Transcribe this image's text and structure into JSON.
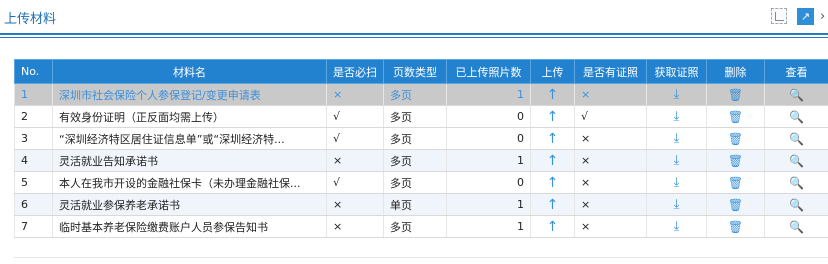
{
  "page": {
    "title": "上传材料"
  },
  "table": {
    "headers": [
      "No.",
      "材料名",
      "是否必扫",
      "页数类型",
      "已上传照片数",
      "上传",
      "是否有证照",
      "获取证照",
      "删除",
      "查看"
    ],
    "rows": [
      {
        "no": "1",
        "name": "深圳市社会保险个人参保登记/变更申请表",
        "required": "×",
        "page_type": "多页",
        "uploaded": "1",
        "upload_icon": "↑",
        "has_license": "×",
        "fetch_icon": "⤓",
        "delete_icon": "🗑",
        "view_icon": "🔍"
      },
      {
        "no": "2",
        "name": "有效身份证明（正反面均需上传）",
        "required": "√",
        "page_type": "多页",
        "uploaded": "0",
        "upload_icon": "↑",
        "has_license": "√",
        "fetch_icon": "⤓",
        "delete_icon": "🗑",
        "view_icon": "🔍"
      },
      {
        "no": "3",
        "name": "“深圳经济特区居住证信息单”或“深圳经济特...",
        "required": "√",
        "page_type": "多页",
        "uploaded": "0",
        "upload_icon": "↑",
        "has_license": "×",
        "fetch_icon": "⤓",
        "delete_icon": "🗑",
        "view_icon": "🔍"
      },
      {
        "no": "4",
        "name": "灵活就业告知承诺书",
        "required": "×",
        "page_type": "多页",
        "uploaded": "1",
        "upload_icon": "↑",
        "has_license": "×",
        "fetch_icon": "⤓",
        "delete_icon": "🗑",
        "view_icon": "🔍"
      },
      {
        "no": "5",
        "name": "本人在我市开设的金融社保卡（未办理金融社保...",
        "required": "√",
        "page_type": "多页",
        "uploaded": "0",
        "upload_icon": "↑",
        "has_license": "×",
        "fetch_icon": "⤓",
        "delete_icon": "🗑",
        "view_icon": "🔍"
      },
      {
        "no": "6",
        "name": "灵活就业参保养老承诺书",
        "required": "×",
        "page_type": "单页",
        "uploaded": "1",
        "upload_icon": "↑",
        "has_license": "×",
        "fetch_icon": "⤓",
        "delete_icon": "🗑",
        "view_icon": "🔍"
      },
      {
        "no": "7",
        "name": "临时基本养老保险缴费账户人员参保告知书",
        "required": "×",
        "page_type": "多页",
        "uploaded": "1",
        "upload_icon": "↑",
        "has_license": "×",
        "fetch_icon": "⤓",
        "delete_icon": "🗑",
        "view_icon": "🔍"
      }
    ]
  },
  "colors": {
    "accent": "#2382d0",
    "selected_row": "#c9c9c9",
    "alt_row": "#f0f5fc"
  },
  "icons": {
    "top": [
      "document-icon",
      "external-link-icon",
      "chevron-right-icon"
    ]
  }
}
